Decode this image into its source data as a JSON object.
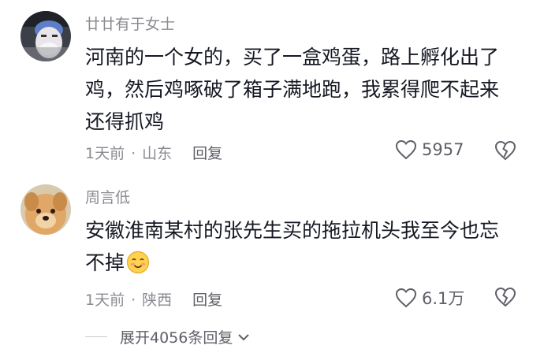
{
  "comments": [
    {
      "username": "廿廿有于女士",
      "text_line1": "河南的一个女的，买了一盒鸡蛋，路上孵化出了",
      "text_line2": "鸡，然后鸡啄破了箱子满地跑，我累得爬不起来",
      "text_line3": "还得抓鸡",
      "time": "1天前",
      "location": "山东",
      "reply_label": "回复",
      "like_count": "5957",
      "avatar_icon": "masked-person-avatar-icon"
    },
    {
      "username": "周言低",
      "text_line1": "安徽淮南某村的张先生买的拖拉机头我至今也忘",
      "text_line2": "不掉",
      "emoji": "smiling-blush-emoji",
      "time": "1天前",
      "location": "陕西",
      "reply_label": "回复",
      "like_count": "6.1万",
      "avatar_icon": "dog-avatar-icon"
    }
  ],
  "expand_replies": "展开4056条回复",
  "colors": {
    "primary_text": "#161823",
    "secondary_text": "#8a8b91",
    "meta_text": "#5f6068"
  }
}
